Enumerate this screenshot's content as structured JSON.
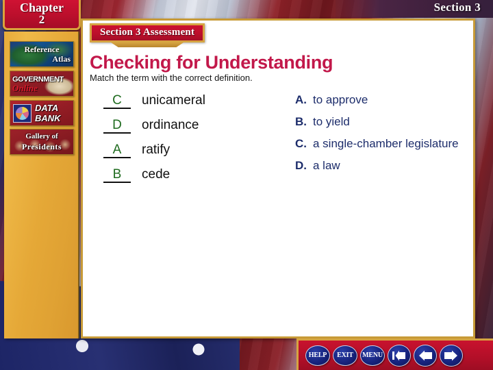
{
  "chapter": {
    "label": "Chapter",
    "number": "2"
  },
  "section_label": "Section 3",
  "sidebar": {
    "buttons": [
      {
        "name": "reference-atlas",
        "line1": "Reference",
        "line2": "Atlas"
      },
      {
        "name": "government-online",
        "line1": "GOVERNMENT",
        "line2": "Online"
      },
      {
        "name": "data-bank",
        "line1": "DATA",
        "line2": "BANK"
      },
      {
        "name": "gallery-of-presidents",
        "line1": "Gallery of",
        "line2": "Presidents"
      }
    ]
  },
  "content": {
    "banner": "Section 3 Assessment",
    "headline": "Checking for Understanding",
    "instructions": "Match the term with the correct definition.",
    "terms": [
      {
        "answer": "C",
        "term": "unicameral"
      },
      {
        "answer": "D",
        "term": "ordinance"
      },
      {
        "answer": "A",
        "term": "ratify"
      },
      {
        "answer": "B",
        "term": "cede"
      }
    ],
    "definitions": [
      {
        "letter": "A.",
        "text": "to approve"
      },
      {
        "letter": "B.",
        "text": "to yield"
      },
      {
        "letter": "C.",
        "text": "a single-chamber legislature"
      },
      {
        "letter": "D.",
        "text": "a law"
      }
    ]
  },
  "navbar": {
    "help": "HELP",
    "exit": "EXIT",
    "menu": "MENU",
    "first_icon": "first-page-arrow-icon",
    "back_icon": "back-arrow-icon",
    "forward_icon": "forward-arrow-icon"
  },
  "colors": {
    "crimson": "#bc0f2b",
    "gold": "#d6a441",
    "headline_red": "#c2184a",
    "answer_green": "#1f6b1f",
    "definition_navy": "#1d2d6b"
  }
}
